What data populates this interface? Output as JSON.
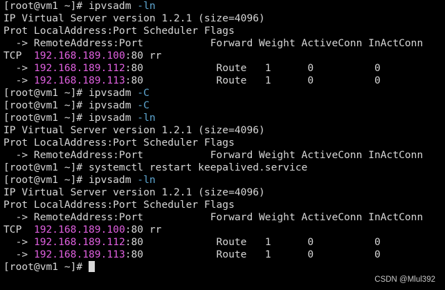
{
  "colors": {
    "background": "#000000",
    "text": "#d7d7d7",
    "option": "#5fa8d3",
    "ip_address": "#e060e0"
  },
  "lines": [
    [
      {
        "t": "[root@vm1 ~]# ipvsadm "
      },
      {
        "t": "-ln",
        "c": "opt"
      }
    ],
    [
      {
        "t": "IP Virtual Server version 1.2.1 (size=4096)"
      }
    ],
    [
      {
        "t": "Prot LocalAddress:Port Scheduler Flags"
      }
    ],
    [
      {
        "t": "  -> RemoteAddress:Port           Forward Weight ActiveConn InActConn"
      }
    ],
    [
      {
        "t": "TCP  "
      },
      {
        "t": "192.168.189.100",
        "c": "ip"
      },
      {
        "t": ":80 rr"
      }
    ],
    [
      {
        "t": "  -> "
      },
      {
        "t": "192.168.189.112",
        "c": "ip"
      },
      {
        "t": ":80            Route   1      0          0"
      }
    ],
    [
      {
        "t": "  -> "
      },
      {
        "t": "192.168.189.113",
        "c": "ip"
      },
      {
        "t": ":80            Route   1      0          0"
      }
    ],
    [
      {
        "t": "[root@vm1 ~]# ipvsadm "
      },
      {
        "t": "-C",
        "c": "opt"
      }
    ],
    [
      {
        "t": "[root@vm1 ~]# ipvsadm "
      },
      {
        "t": "-C",
        "c": "opt"
      }
    ],
    [
      {
        "t": "[root@vm1 ~]# ipvsadm "
      },
      {
        "t": "-ln",
        "c": "opt"
      }
    ],
    [
      {
        "t": "IP Virtual Server version 1.2.1 (size=4096)"
      }
    ],
    [
      {
        "t": "Prot LocalAddress:Port Scheduler Flags"
      }
    ],
    [
      {
        "t": "  -> RemoteAddress:Port           Forward Weight ActiveConn InActConn"
      }
    ],
    [
      {
        "t": "[root@vm1 ~]# systemctl restart keepalived.service"
      }
    ],
    [
      {
        "t": "[root@vm1 ~]# ipvsadm "
      },
      {
        "t": "-ln",
        "c": "opt"
      }
    ],
    [
      {
        "t": "IP Virtual Server version 1.2.1 (size=4096)"
      }
    ],
    [
      {
        "t": "Prot LocalAddress:Port Scheduler Flags"
      }
    ],
    [
      {
        "t": "  -> RemoteAddress:Port           Forward Weight ActiveConn InActConn"
      }
    ],
    [
      {
        "t": "TCP  "
      },
      {
        "t": "192.168.189.100",
        "c": "ip"
      },
      {
        "t": ":80 rr"
      }
    ],
    [
      {
        "t": "  -> "
      },
      {
        "t": "192.168.189.112",
        "c": "ip"
      },
      {
        "t": ":80            Route   1      0          0"
      }
    ],
    [
      {
        "t": "  -> "
      },
      {
        "t": "192.168.189.113",
        "c": "ip"
      },
      {
        "t": ":80            Route   1      0          0"
      }
    ]
  ],
  "prompt": {
    "text": "[root@vm1 ~]# ",
    "cursor": "block"
  },
  "watermark": "CSDN @Mlul392"
}
